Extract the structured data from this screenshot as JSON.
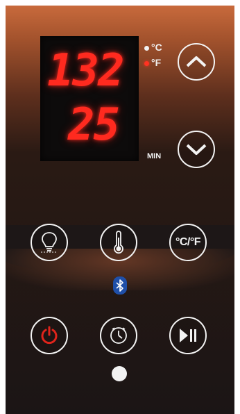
{
  "display": {
    "temperature": "132",
    "time_remaining": "25",
    "time_unit": "MIN"
  },
  "units": {
    "celsius": "°C",
    "fahrenheit": "°F",
    "active": "fahrenheit",
    "toggle_label": "°C/°F"
  },
  "buttons": {
    "up": "chevron-up-icon",
    "down": "chevron-down-icon",
    "light": "light-bulb-icon",
    "temperature": "thermometer-icon",
    "unit_toggle": "°C/°F",
    "power": "power-icon",
    "timer": "clock-icon",
    "play_pause": "play-pause-icon"
  },
  "status": {
    "bluetooth": "bluetooth-icon"
  },
  "colors": {
    "led_red": "#ff2a1f",
    "power_red": "#e0241b",
    "bluetooth_blue": "#1f4fa8",
    "border_white": "#f3f3f3"
  }
}
